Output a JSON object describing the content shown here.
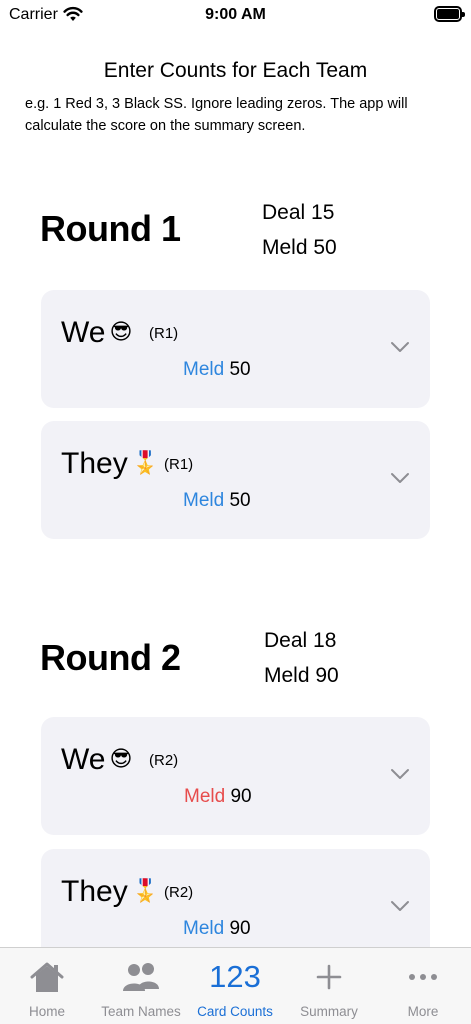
{
  "status_bar": {
    "carrier": "Carrier",
    "time": "9:00 AM"
  },
  "header": {
    "title": "Enter Counts for Each Team",
    "instructions": "e.g. 1 Red 3, 3 Black SS. Ignore leading zeros.  The app will calculate the score on the summary screen."
  },
  "rounds": [
    {
      "title": "Round 1",
      "deal": "Deal 15",
      "meld": "Meld 50",
      "teams": [
        {
          "name": "We",
          "emoji": "😎",
          "tag": "(R1)",
          "meld_label": "Meld",
          "meld_value": "50",
          "meld_color": "#2e86de"
        },
        {
          "name": "They",
          "emoji": "🎖️",
          "tag": "(R1)",
          "meld_label": "Meld",
          "meld_value": "50",
          "meld_color": "#2e86de"
        }
      ]
    },
    {
      "title": "Round 2",
      "deal": "Deal 18",
      "meld": "Meld 90",
      "teams": [
        {
          "name": "We",
          "emoji": "😎",
          "tag": "(R2)",
          "meld_label": "Meld",
          "meld_value": "90",
          "meld_color": "#e74c4c"
        },
        {
          "name": "They",
          "emoji": "🎖️",
          "tag": "(R2)",
          "meld_label": "Meld",
          "meld_value": "90",
          "meld_color": "#2e86de"
        }
      ]
    }
  ],
  "tab_bar": {
    "tabs": [
      {
        "label": "Home",
        "icon": "house-icon"
      },
      {
        "label": "Team Names",
        "icon": "people-icon"
      },
      {
        "label": "Card Counts",
        "icon": "123",
        "active": true
      },
      {
        "label": "Summary",
        "icon": "plus-icon"
      },
      {
        "label": "More",
        "icon": "ellipsis-icon"
      }
    ]
  }
}
